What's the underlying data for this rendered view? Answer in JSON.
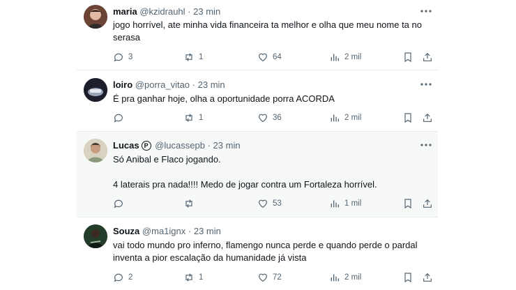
{
  "tweets": [
    {
      "name": "maria",
      "handle": "@kzidrauhl",
      "time": "23 min",
      "verified": false,
      "text": "jogo horrível, ate minha vida financeira ta melhor e olha que meu nome ta no serasa",
      "replies": "3",
      "retweets": "1",
      "likes": "64",
      "views": "2 mil",
      "avatar_color": "#8a5a4a"
    },
    {
      "name": "loiro",
      "handle": "@porra_vitao",
      "time": "23 min",
      "verified": false,
      "text": "É pra ganhar hoje, olha a oportunidade porra ACORDA",
      "replies": "",
      "retweets": "1",
      "likes": "36",
      "views": "2 mil",
      "avatar_color": "#1c1f2b"
    },
    {
      "name": "Lucas",
      "handle": "@lucassepb",
      "time": "23 min",
      "verified": true,
      "badge_glyph": "P",
      "text": "Só Anibal e Flaco jogando.\n\n4 laterais pra nada!!!! Medo de jogar contra um Fortaleza horrível.",
      "replies": "",
      "retweets": "",
      "likes": "53",
      "views": "1 mil",
      "avatar_color": "#c9c3b0"
    },
    {
      "name": "Souza",
      "handle": "@ma1ignx",
      "time": "23 min",
      "verified": false,
      "text": "vai todo mundo pro inferno, flamengo nunca perde e quando perde o pardal inventa a pior escalação da humanidade já vista",
      "replies": "2",
      "retweets": "1",
      "likes": "72",
      "views": "2 mil",
      "avatar_color": "#1f3b24"
    }
  ],
  "separator": "·"
}
